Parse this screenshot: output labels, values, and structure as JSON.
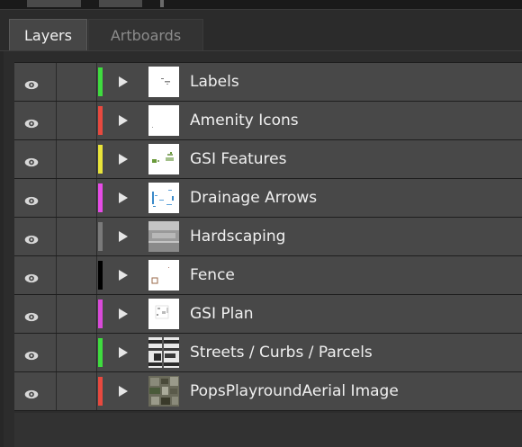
{
  "tabs": [
    {
      "label": "Layers",
      "active": true
    },
    {
      "label": "Artboards",
      "active": false
    }
  ],
  "icons": {
    "visibility": "eye-icon",
    "expand": "disclosure-triangle-icon"
  },
  "layers": [
    {
      "name": "Labels",
      "color": "#3fdc3f",
      "thumb": "labels"
    },
    {
      "name": "Amenity Icons",
      "color": "#e8493f",
      "thumb": "amenity"
    },
    {
      "name": "GSI Features",
      "color": "#e9e43a",
      "thumb": "gsi-features"
    },
    {
      "name": "Drainage Arrows",
      "color": "#e64ce6",
      "thumb": "drainage"
    },
    {
      "name": "Hardscaping",
      "color": "#7a7a7a",
      "thumb": "hardscaping"
    },
    {
      "name": "Fence",
      "color": "#000000",
      "thumb": "fence"
    },
    {
      "name": "GSI Plan",
      "color": "#d94ad9",
      "thumb": "gsi-plan"
    },
    {
      "name": "Streets / Curbs / Parcels",
      "color": "#3fdc3f",
      "thumb": "streets"
    },
    {
      "name": "PopsPlayroundAerial Image",
      "color": "#e8493f",
      "thumb": "aerial"
    }
  ]
}
